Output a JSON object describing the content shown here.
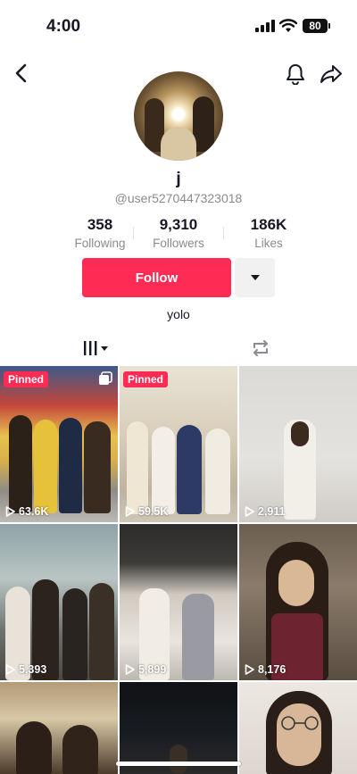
{
  "status": {
    "time": "4:00",
    "battery": "80"
  },
  "profile": {
    "username": "j",
    "handle": "@user5270447323018",
    "bio": "yolo"
  },
  "stats": [
    {
      "value": "358",
      "label": "Following"
    },
    {
      "value": "9,310",
      "label": "Followers"
    },
    {
      "value": "186K",
      "label": "Likes"
    }
  ],
  "actions": {
    "follow_label": "Follow"
  },
  "tabs": {
    "videos_icon": "grid-icon",
    "reposts_icon": "repost-icon"
  },
  "colors": {
    "accent": "#fe2c55",
    "muted": "#8a8b91"
  },
  "videos": [
    {
      "views": "63.6K",
      "pinned": "Pinned",
      "multi": true
    },
    {
      "views": "59.5K",
      "pinned": "Pinned"
    },
    {
      "views": "2,911"
    },
    {
      "views": "5,393"
    },
    {
      "views": "5,899"
    },
    {
      "views": "8,176"
    },
    {
      "views": ""
    },
    {
      "views": ""
    },
    {
      "views": ""
    }
  ]
}
